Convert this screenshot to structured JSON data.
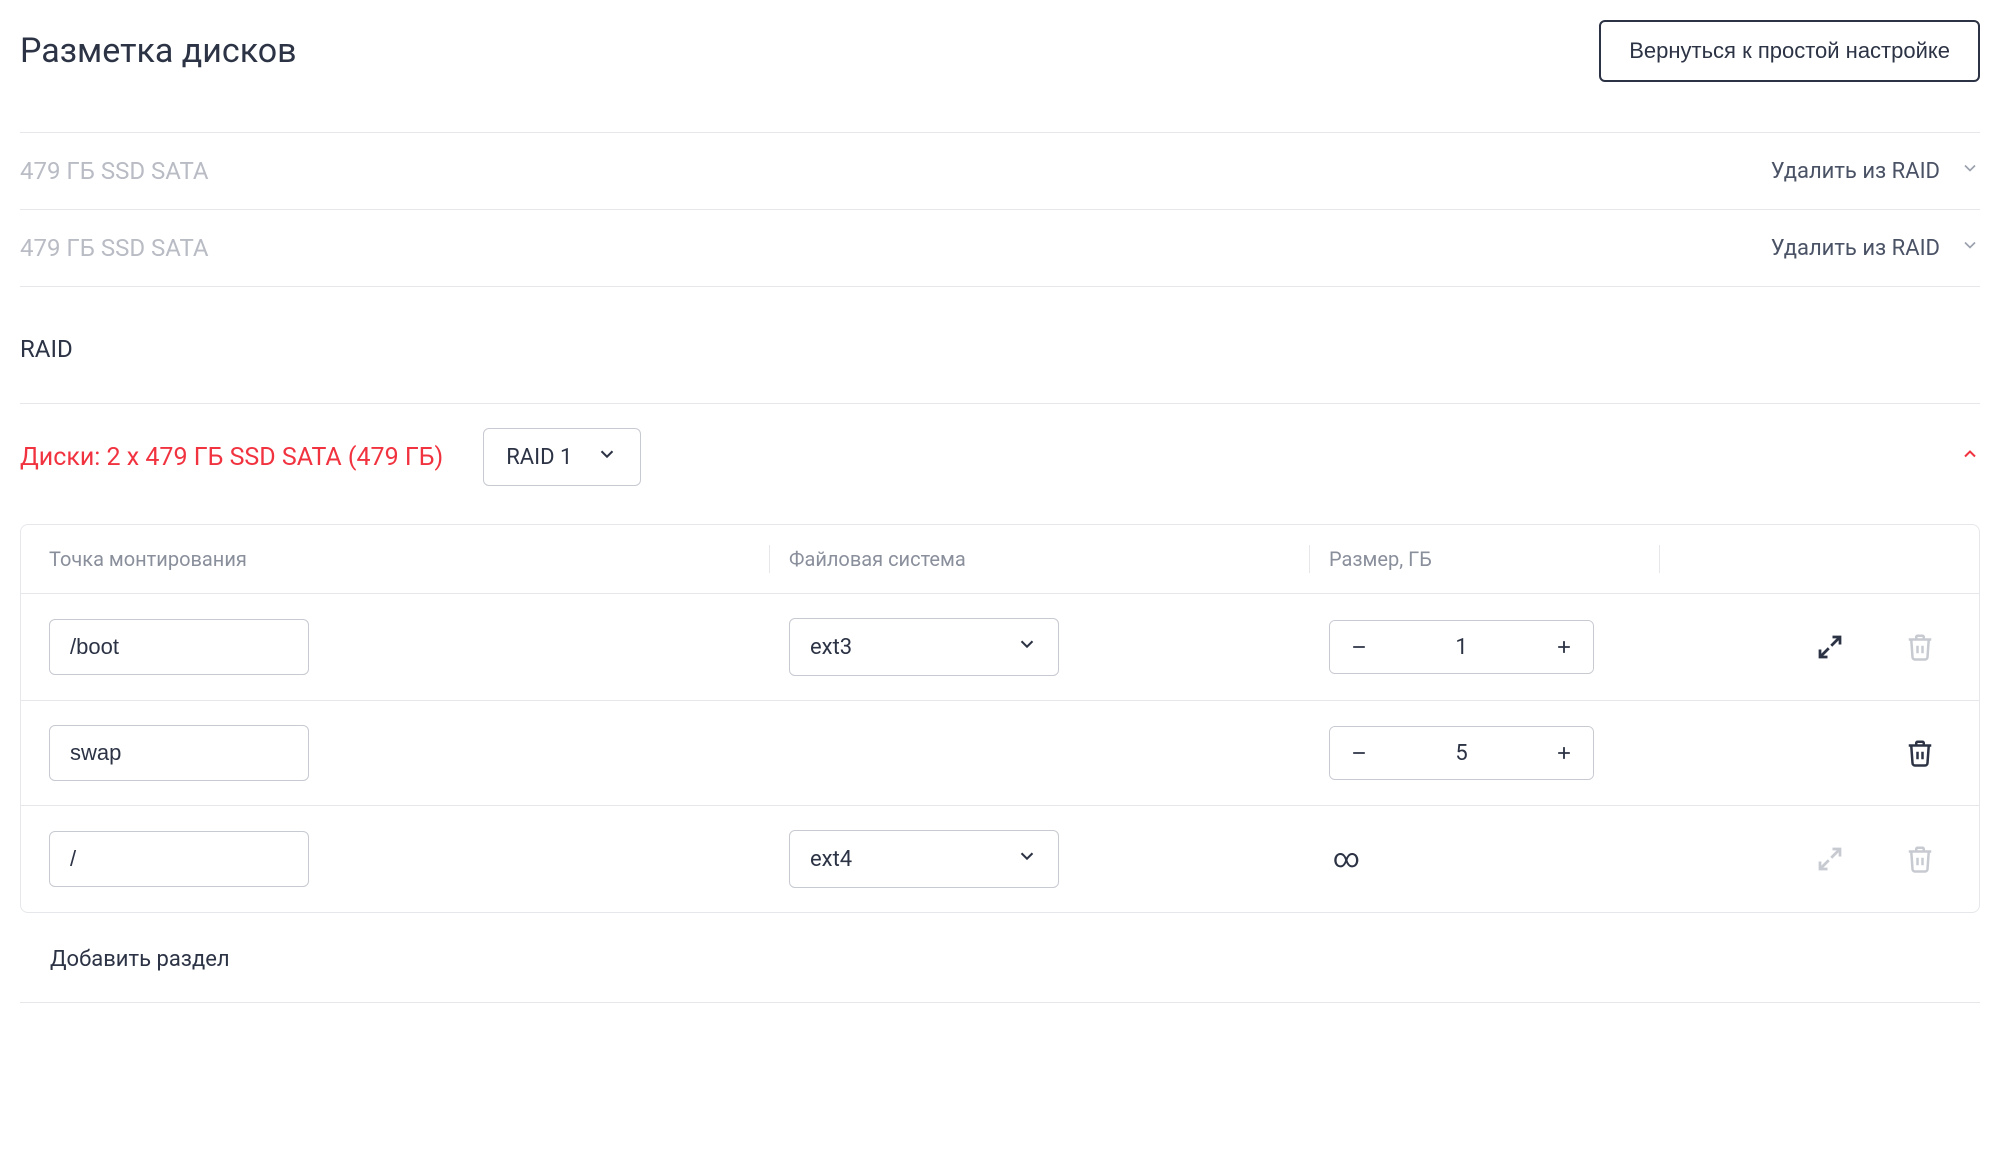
{
  "header": {
    "title": "Разметка дисков",
    "back_button": "Вернуться к простой настройке"
  },
  "disks": [
    {
      "name": "479 ГБ SSD SATA",
      "action": "Удалить из RAID"
    },
    {
      "name": "479 ГБ SSD SATA",
      "action": "Удалить из RAID"
    }
  ],
  "raid_section_label": "RAID",
  "raid": {
    "disks_summary": "Диски: 2 x 479 ГБ SSD SATA (479 ГБ)",
    "level": "RAID 1"
  },
  "table": {
    "headers": {
      "mount": "Точка монтирования",
      "fs": "Файловая система",
      "size": "Размер, ГБ"
    },
    "rows": [
      {
        "mount": "/boot",
        "fs": "ext3",
        "size": "1",
        "expand_enabled": true,
        "delete_enabled": false,
        "show_fs": true,
        "show_stepper": true
      },
      {
        "mount": "swap",
        "fs": "",
        "size": "5",
        "expand_enabled": false,
        "delete_enabled": true,
        "show_fs": false,
        "show_stepper": true
      },
      {
        "mount": "/",
        "fs": "ext4",
        "size": "∞",
        "expand_enabled": false,
        "delete_enabled": false,
        "show_fs": true,
        "show_stepper": false
      }
    ]
  },
  "add_partition": "Добавить раздел",
  "icons": {
    "infinity": "∞"
  }
}
